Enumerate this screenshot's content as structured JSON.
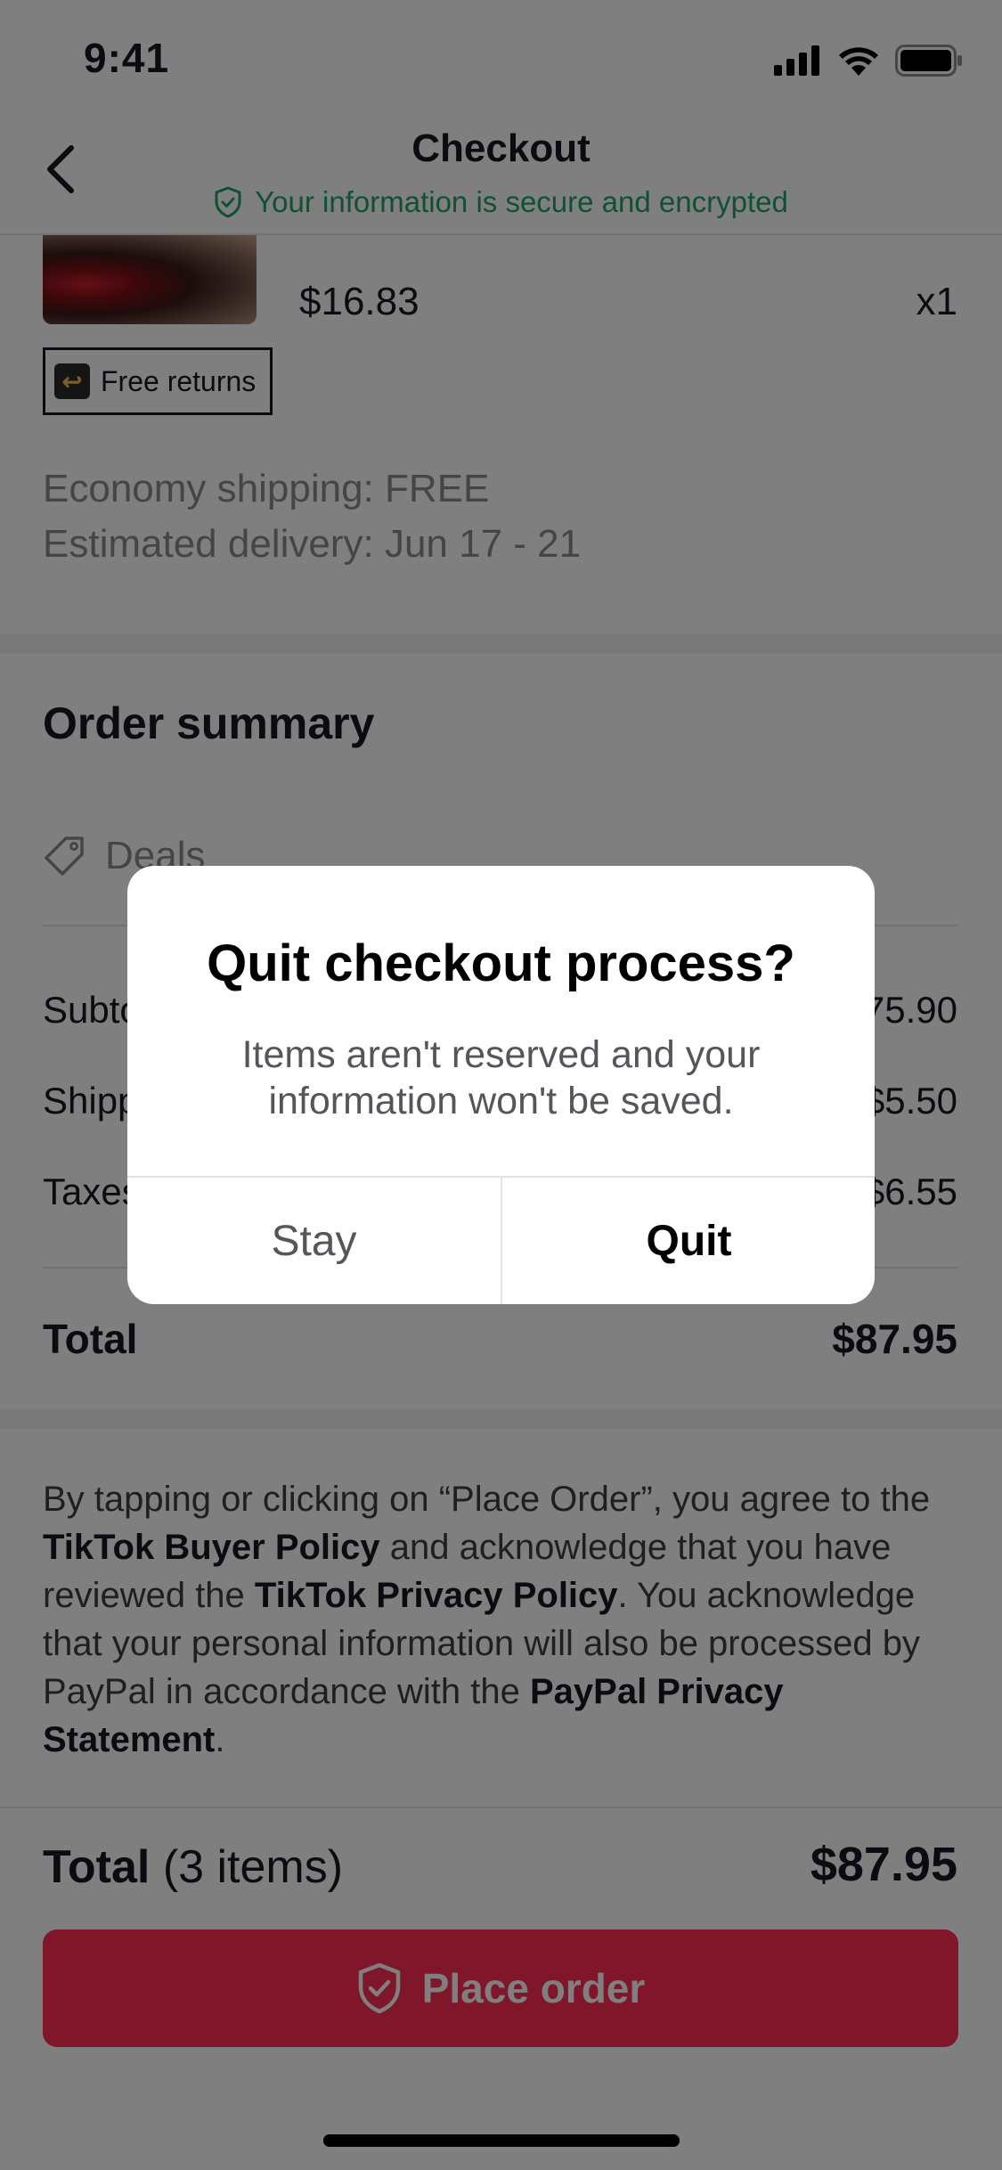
{
  "status_bar": {
    "time": "9:41"
  },
  "header": {
    "title": "Checkout",
    "secure_text": "Your information is secure and encrypted"
  },
  "product": {
    "price": "$16.83",
    "quantity": "x1",
    "badge": "Free returns"
  },
  "shipping": {
    "method_label": "Economy shipping:",
    "method_value": "FREE",
    "delivery_label": "Estimated delivery:",
    "delivery_dates": "Jun 17 - 21"
  },
  "summary": {
    "title": "Order summary",
    "deals_label": "Deals",
    "rows": [
      {
        "label": "Subtotal",
        "value": "$75.90"
      },
      {
        "label": "Shipping",
        "value": "$5.50"
      },
      {
        "label": "Taxes",
        "value": "$6.55"
      }
    ],
    "total_label": "Total",
    "total_value": "$87.95"
  },
  "legal": {
    "part1": "By tapping or clicking on “Place Order”, you agree to the ",
    "link1": "TikTok Buyer Policy",
    "part2": " and acknowledge that you have reviewed the ",
    "link2": "TikTok Privacy Policy",
    "part3": ". You acknowledge that your personal information will also be processed by PayPal in accordance with the ",
    "link3": "PayPal Privacy Statement",
    "part4": "."
  },
  "footer": {
    "total_label": "Total",
    "items_count": "(3 items)",
    "total_value": "$87.95",
    "place_order_label": "Place order"
  },
  "dialog": {
    "title": "Quit checkout process?",
    "message": "Items aren't reserved and your information won't be saved.",
    "stay_label": "Stay",
    "quit_label": "Quit"
  },
  "colors": {
    "accent": "#fe2c55",
    "secure_green": "#20a36a"
  }
}
